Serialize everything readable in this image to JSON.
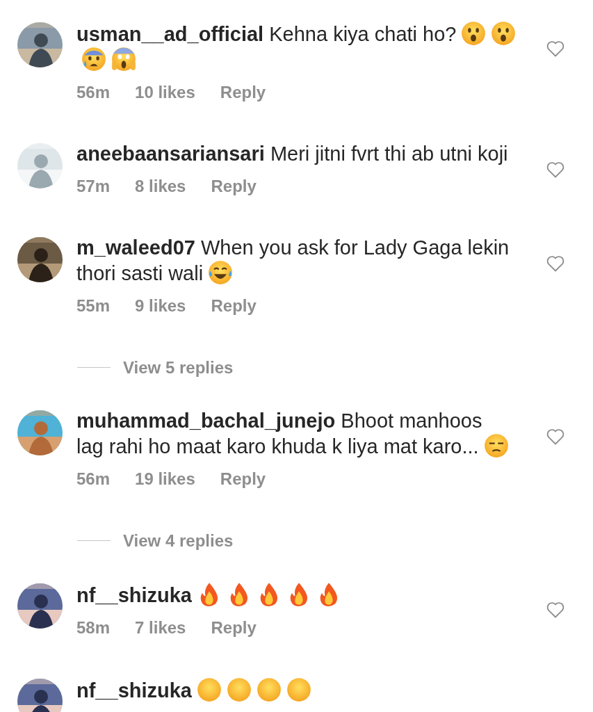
{
  "comments": [
    {
      "kind": "comment",
      "lines": [
        "**usman__ad_official** Kehna kiya chati ho?"
      ],
      "emojis": [
        {
          "kind": "surprised"
        },
        {
          "kind": "surprised"
        },
        {
          "kind": "anxious"
        },
        {
          "kind": "scream"
        }
      ],
      "time": "56m",
      "likes": "10 likes",
      "reply": "Reply",
      "liked": false
    },
    {
      "kind": "comment",
      "lines": [
        "**aneebaansariansari** Meri jitni fvrt thi ab utni koji"
      ],
      "time": "57m",
      "likes": "8 likes",
      "reply": "Reply",
      "liked": false
    },
    {
      "kind": "comment",
      "lines": [
        "**m_waleed07** When you ask for Lady Gaga lekin",
        "thori sasti wali"
      ],
      "emojis": [
        {
          "kind": "laughing"
        }
      ],
      "time": "55m",
      "likes": "9 likes",
      "reply": "Reply",
      "liked": false
    },
    {
      "kind": "view_replies",
      "text": "View 5 replies"
    },
    {
      "kind": "comment",
      "lines": [
        "**muhammad_bachal_junejo** Bhoot manhoos",
        "lag rahi ho maat karo khuda k liya mat karo..."
      ],
      "emojis": [
        {
          "kind": "unamused"
        }
      ],
      "time": "56m",
      "likes": "19 likes",
      "reply": "Reply",
      "liked": false
    },
    {
      "kind": "view_replies",
      "text": "View 4 replies"
    },
    {
      "kind": "comment",
      "lines": [
        "**nf__shizuka**"
      ],
      "emojis": [
        {
          "kind": "fire"
        },
        {
          "kind": "fire"
        },
        {
          "kind": "fire"
        },
        {
          "kind": "fire"
        },
        {
          "kind": "fire"
        }
      ],
      "time": "58m",
      "likes": "7 likes",
      "reply": "Reply",
      "liked": false
    },
    {
      "kind": "comment",
      "lines": [
        "**nf__shizuka**"
      ],
      "emojis": [
        {
          "kind": "face"
        },
        {
          "kind": "face"
        },
        {
          "kind": "face"
        },
        {
          "kind": "face"
        }
      ]
    }
  ]
}
